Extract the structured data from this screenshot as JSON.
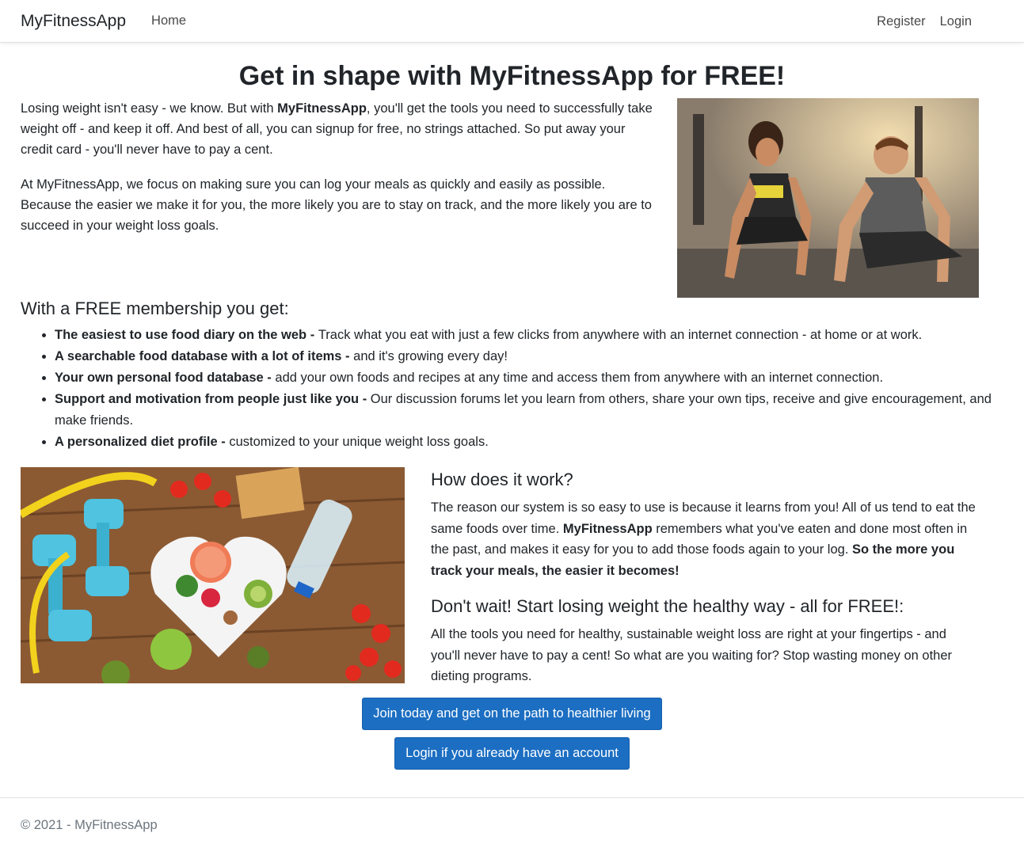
{
  "nav": {
    "brand": "MyFitnessApp",
    "home": "Home",
    "register": "Register",
    "login": "Login"
  },
  "hero": {
    "title": "Get in shape with MyFitnessApp for FREE!",
    "p1_a": "Losing weight isn't easy - we know. But with ",
    "p1_b": "MyFitnessApp",
    "p1_c": ", you'll get the tools you need to successfully take weight off - and keep it off. And best of all, you can signup for free, no strings attached. So put away your credit card - you'll never have to pay a cent.",
    "p2": "At MyFitnessApp, we focus on making sure you can log your meals as quickly and easily as possible. Because the easier we make it for you, the more likely you are to stay on track, and the more likely you are to succeed in your weight loss goals."
  },
  "membership": {
    "title": "With a FREE membership you get:",
    "items": [
      {
        "bold": "The easiest to use food diary on the web - ",
        "text": "Track what you eat with just a few clicks from anywhere with an internet connection - at home or at work."
      },
      {
        "bold": "A searchable food database with a lot of items - ",
        "text": "and it's growing every day!"
      },
      {
        "bold": "Your own personal food database - ",
        "text": "add your own foods and recipes at any time and access them from anywhere with an internet connection."
      },
      {
        "bold": "Support and motivation from people just like you - ",
        "text": "Our discussion forums let you learn from others, share your own tips, receive and give encouragement, and make friends."
      },
      {
        "bold": "A personalized diet profile - ",
        "text": "customized to your unique weight loss goals."
      }
    ]
  },
  "how": {
    "title": "How does it work?",
    "p_a": "The reason our system is so easy to use is because it learns from you! All of us tend to eat the same foods over time. ",
    "p_b": "MyFitnessApp",
    "p_c": " remembers what you've eaten and done most often in the past, and makes it easy for you to add those foods again to your log. ",
    "p_d": "So the more you track your meals, the easier it becomes!"
  },
  "wait": {
    "title": "Don't wait! Start losing weight the healthy way - all for FREE!:",
    "p": "All the tools you need for healthy, sustainable weight loss are right at your fingertips - and you'll never have to pay a cent! So what are you waiting for? Stop wasting money on other dieting programs."
  },
  "buttons": {
    "join": "Join today and get on the path to healthier living",
    "login": "Login if you already have an account"
  },
  "footer": {
    "text": "© 2021 - MyFitnessApp"
  },
  "colors": {
    "primary": "#1b6ec2",
    "text": "#212529",
    "muted": "#6c757d"
  }
}
